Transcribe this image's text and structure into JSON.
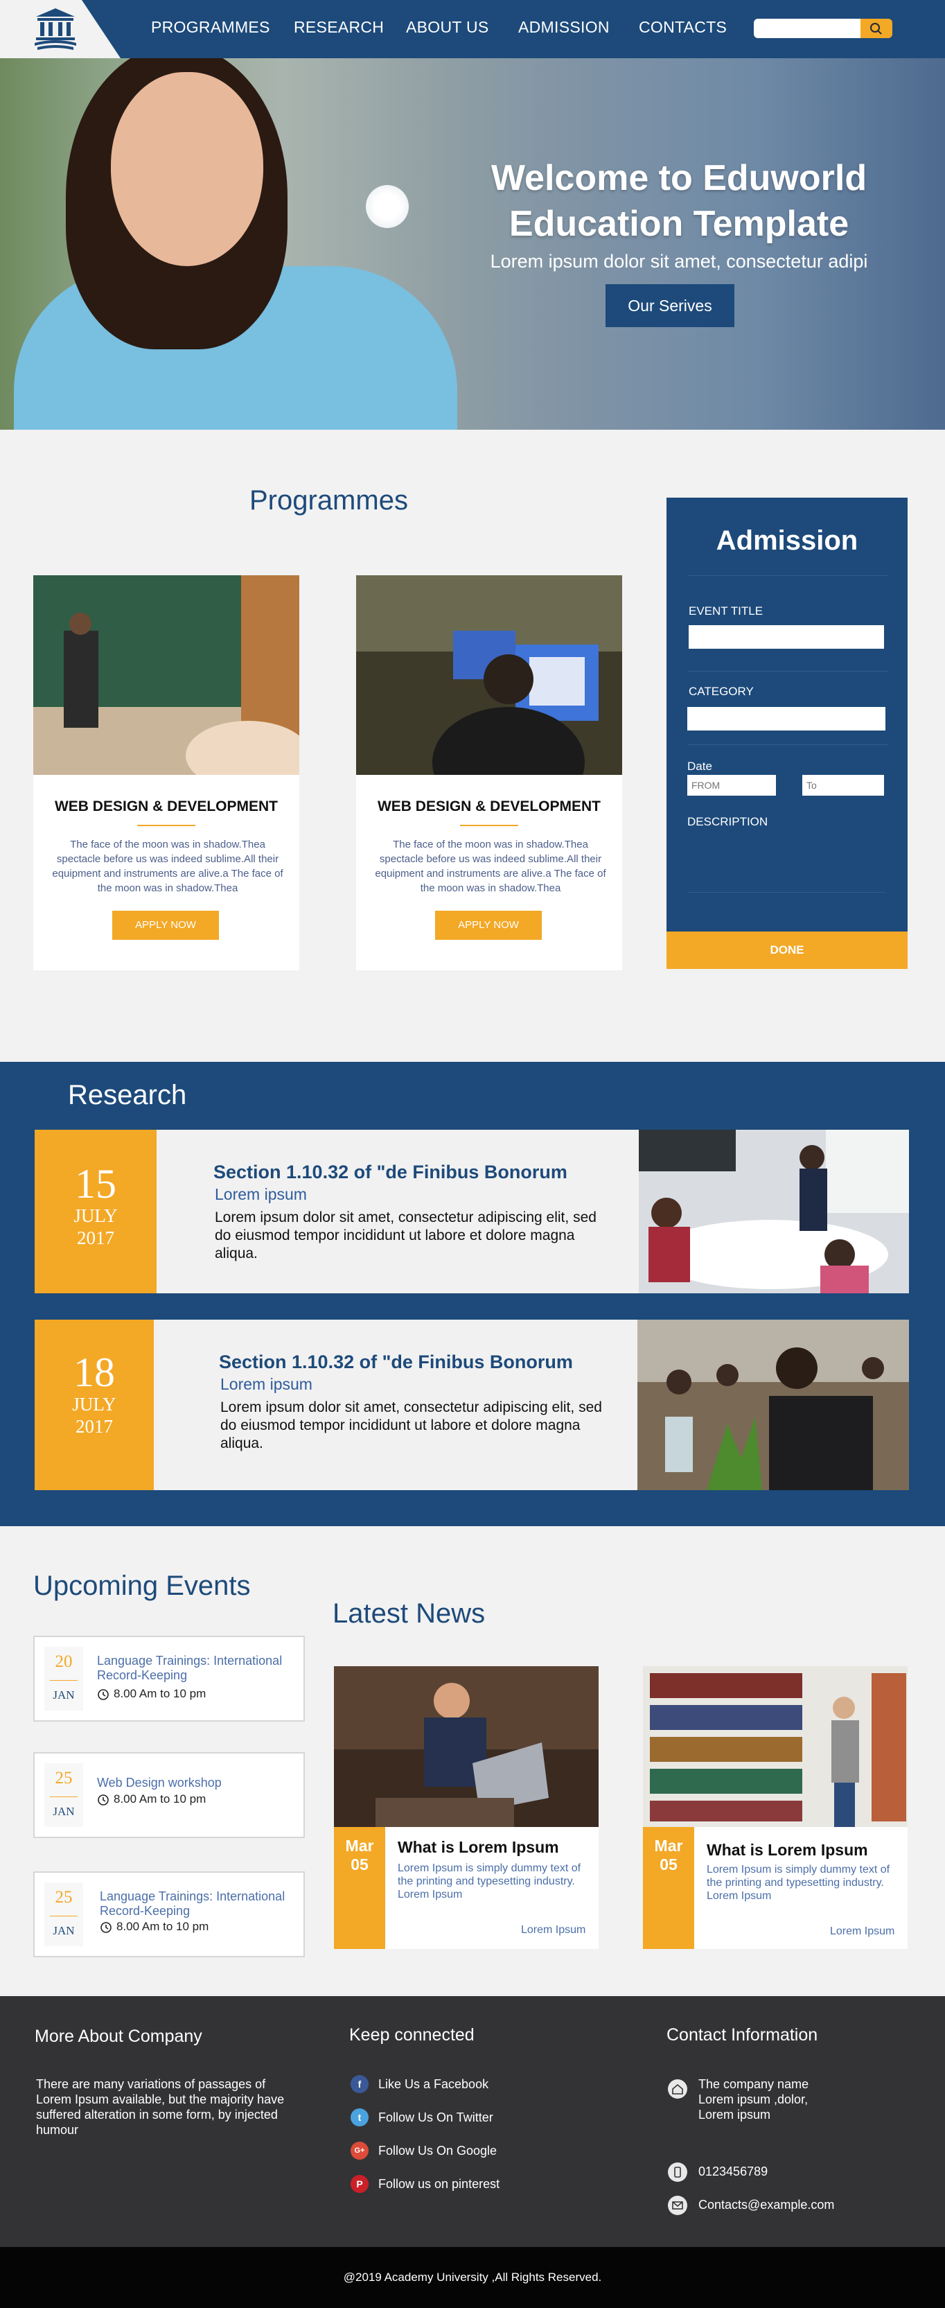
{
  "nav": {
    "items": [
      "PROGRAMMES",
      "RESEARCH",
      "ABOUT US",
      "ADMISSION",
      "CONTACTS"
    ],
    "search_placeholder": ""
  },
  "hero": {
    "title": "Welcome to Eduworld Education Template",
    "subtitle": "Lorem ipsum dolor sit amet, consectetur adipi",
    "button": "Our Serives"
  },
  "programmes": {
    "title": "Programmes",
    "cards": [
      {
        "title": "WEB DESIGN & DEVELOPMENT",
        "text": "The face of the moon was in shadow.Thea spectacle before us was indeed sublime.All their equipment and instruments are alive.a The face of the moon was in shadow.Thea",
        "button": "APPLY NOW"
      },
      {
        "title": "WEB DESIGN & DEVELOPMENT",
        "text": "The face of the moon was in shadow.Thea spectacle before us was indeed sublime.All their equipment and instruments are alive.a The face of the moon was in shadow.Thea",
        "button": "APPLY NOW"
      }
    ]
  },
  "admission": {
    "title": "Admission",
    "event_title_label": "EVENT TITLE",
    "category_label": "CATEGORY",
    "date_label": "Date",
    "from_placeholder": "FROM",
    "to_placeholder": "To",
    "description_label": "DESCRIPTION",
    "done": "DONE"
  },
  "research": {
    "title": "Research",
    "items": [
      {
        "day": "15",
        "month": "JULY",
        "year": "2017",
        "title": "Section 1.10.32 of \"de Finibus Bonorum",
        "subtitle": "Lorem ipsum",
        "text": "Lorem ipsum dolor sit amet, consectetur adipiscing elit, sed do eiusmod tempor incididunt ut labore et dolore magna aliqua."
      },
      {
        "day": "18",
        "month": "JULY",
        "year": "2017",
        "title": "Section 1.10.32 of \"de Finibus Bonorum",
        "subtitle": "Lorem ipsum",
        "text": "Lorem ipsum dolor sit amet, consectetur adipiscing elit, sed do eiusmod tempor incididunt ut labore et dolore magna aliqua."
      }
    ]
  },
  "events": {
    "title": "Upcoming Events",
    "items": [
      {
        "day": "20",
        "month": "JAN",
        "title": "Language Trainings: International Record-Keeping",
        "time": "8.00 Am to 10 pm"
      },
      {
        "day": "25",
        "month": "JAN",
        "title": "Web Design workshop",
        "time": "8.00 Am to 10 pm"
      },
      {
        "day": "25",
        "month": "JAN",
        "title": "Language Trainings: International Record-Keeping",
        "time": "8.00 Am to 10 pm"
      }
    ]
  },
  "news": {
    "title": "Latest News",
    "items": [
      {
        "month": "Mar",
        "day": "05",
        "title": "What is Lorem Ipsum",
        "text": "Lorem Ipsum is simply dummy text of the printing and typesetting industry. Lorem Ipsum",
        "more": "Lorem Ipsum"
      },
      {
        "month": "Mar",
        "day": "05",
        "title": "What is Lorem Ipsum",
        "text": "Lorem Ipsum is simply dummy text of the printing and typesetting industry. Lorem Ipsum",
        "more": "Lorem Ipsum"
      }
    ]
  },
  "footer": {
    "about": {
      "title": "More About Company",
      "text": "There are many variations of passages of Lorem Ipsum available, but the majority have suffered alteration in some form, by injected humour"
    },
    "social": {
      "title": "Keep connected",
      "items": [
        {
          "label": "Like Us a Facebook",
          "icon": "facebook-icon",
          "color": "#3b5998",
          "glyph": "f"
        },
        {
          "label": "Follow Us On Twitter",
          "icon": "twitter-icon",
          "color": "#4aa3df",
          "glyph": "t"
        },
        {
          "label": "Follow Us On Google",
          "icon": "google-plus-icon",
          "color": "#dd4b39",
          "glyph": "G+"
        },
        {
          "label": "Follow us on pinterest",
          "icon": "pinterest-icon",
          "color": "#cb2027",
          "glyph": "P"
        }
      ]
    },
    "contact": {
      "title": "Contact Information",
      "address": "The company name Lorem ipsum ,dolor, Lorem ipsum",
      "phone": "0123456789",
      "email": "Contacts@example.com"
    },
    "copyright": "@2019 Academy University ,All Rights Reserved."
  },
  "colors": {
    "primary": "#1d4a7a",
    "accent": "#f3a826",
    "footer": "#333336"
  }
}
